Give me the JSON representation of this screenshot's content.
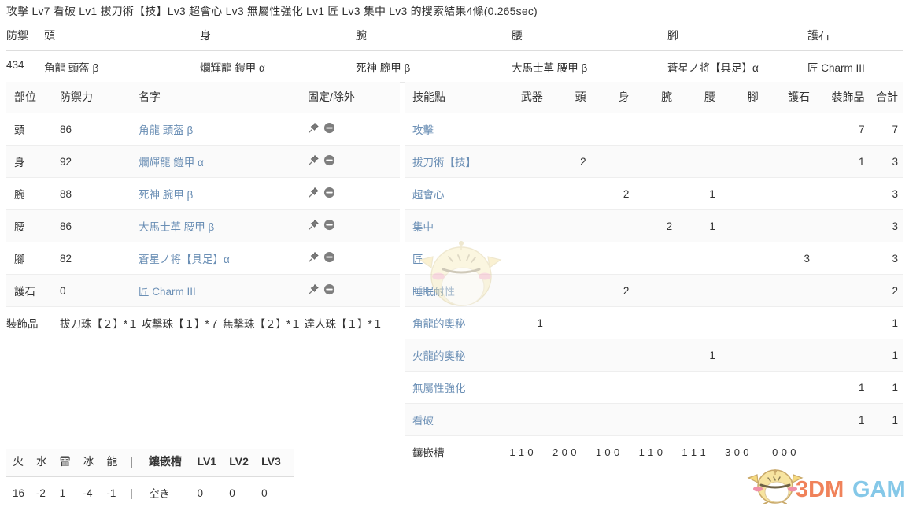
{
  "search": {
    "line": "攻擊 Lv7 看破 Lv1 拔刀術【技】Lv3 超會心 Lv3 無屬性強化 Lv1 匠 Lv3 集中 Lv3 的搜索結果4條(0.265sec)"
  },
  "summary": {
    "headers": [
      "防禦",
      "頭",
      "身",
      "腕",
      "腰",
      "腳",
      "護石"
    ],
    "row": [
      "434",
      "角龍 頭盔 β",
      "爛輝龍 鎧甲 α",
      "死神 腕甲 β",
      "大馬士革 腰甲 β",
      "蒼星ノ将【具足】α",
      "匠 Charm III"
    ]
  },
  "gear": {
    "headers": [
      "部位",
      "防禦力",
      "名字",
      "固定/除外"
    ],
    "rows": [
      {
        "part": "頭",
        "defense": "86",
        "name": "角龍 頭盔 β"
      },
      {
        "part": "身",
        "defense": "92",
        "name": "爛輝龍 鎧甲 α"
      },
      {
        "part": "腕",
        "defense": "88",
        "name": "死神 腕甲 β"
      },
      {
        "part": "腰",
        "defense": "86",
        "name": "大馬士革 腰甲 β"
      },
      {
        "part": "腳",
        "defense": "82",
        "name": "蒼星ノ将【具足】α"
      },
      {
        "part": "護石",
        "defense": "0",
        "name": "匠 Charm III"
      }
    ],
    "deco_label": "裝飾品",
    "deco_value": "拔刀珠【２】*１ 攻擊珠【１】*７ 無擊珠【２】*１ 達人珠【１】*１",
    "icons": {
      "pin": "pushpin-icon",
      "exclude": "minus-circle-icon"
    }
  },
  "skills": {
    "headers": [
      "技能點",
      "武器",
      "頭",
      "身",
      "腕",
      "腰",
      "腳",
      "護石",
      "裝飾品",
      "合計"
    ],
    "rows": [
      {
        "name": "攻擊",
        "weapon": "",
        "head": "",
        "body": "",
        "arms": "",
        "waist": "",
        "legs": "",
        "charm": "",
        "deco": "7",
        "total": "7"
      },
      {
        "name": "拔刀術【技】",
        "weapon": "",
        "head": "2",
        "body": "",
        "arms": "",
        "waist": "",
        "legs": "",
        "charm": "",
        "deco": "1",
        "total": "3"
      },
      {
        "name": "超會心",
        "weapon": "",
        "head": "",
        "body": "2",
        "arms": "",
        "waist": "1",
        "legs": "",
        "charm": "",
        "deco": "",
        "total": "3"
      },
      {
        "name": "集中",
        "weapon": "",
        "head": "",
        "body": "",
        "arms": "2",
        "waist": "1",
        "legs": "",
        "charm": "",
        "deco": "",
        "total": "3"
      },
      {
        "name": "匠",
        "weapon": "",
        "head": "",
        "body": "",
        "arms": "",
        "waist": "",
        "legs": "",
        "charm": "3",
        "deco": "",
        "total": "3"
      },
      {
        "name": "睡眠耐性",
        "weapon": "",
        "head": "",
        "body": "2",
        "arms": "",
        "waist": "",
        "legs": "",
        "charm": "",
        "deco": "",
        "total": "2"
      },
      {
        "name": "角龍的奧秘",
        "weapon": "1",
        "head": "",
        "body": "",
        "arms": "",
        "waist": "",
        "legs": "",
        "charm": "",
        "deco": "",
        "total": "1"
      },
      {
        "name": "火龍的奧秘",
        "weapon": "",
        "head": "",
        "body": "",
        "arms": "",
        "waist": "1",
        "legs": "",
        "charm": "",
        "deco": "",
        "total": "1"
      },
      {
        "name": "無屬性強化",
        "weapon": "",
        "head": "",
        "body": "",
        "arms": "",
        "waist": "",
        "legs": "",
        "charm": "",
        "deco": "1",
        "total": "1"
      },
      {
        "name": "看破",
        "weapon": "",
        "head": "",
        "body": "",
        "arms": "",
        "waist": "",
        "legs": "",
        "charm": "",
        "deco": "1",
        "total": "1"
      }
    ],
    "slots_label": "鑲嵌槽",
    "slots": [
      "1-1-0",
      "2-0-0",
      "1-0-0",
      "1-1-0",
      "1-1-1",
      "3-0-0",
      "0-0-0"
    ]
  },
  "resist": {
    "headers": [
      "火",
      "水",
      "雷",
      "冰",
      "龍",
      "|",
      "鑲嵌槽",
      "LV1",
      "LV2",
      "LV3"
    ],
    "values": [
      "16",
      "-2",
      "1",
      "-4",
      "-1",
      "|",
      "空き",
      "0",
      "0",
      "0"
    ]
  },
  "watermark": {
    "text_3dm": "3DM",
    "text_game": "GAME"
  },
  "colors": {
    "link": "#6b8fb5",
    "text": "#333333",
    "border": "#dddddd",
    "row_alt": "#fafafa",
    "wm_orange": "#f08a5d",
    "wm_blue": "#7ec8e3",
    "wm_body": "#f7e6a8"
  }
}
